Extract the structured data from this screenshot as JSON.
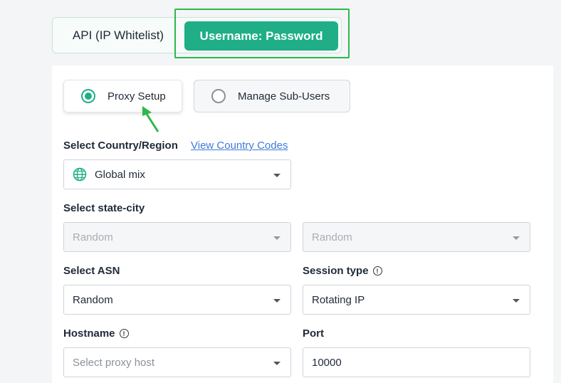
{
  "auth_tabs": {
    "api_label": "API (IP Whitelist)",
    "userpass_label": "Username: Password"
  },
  "mode_options": {
    "proxy_setup": "Proxy Setup",
    "manage_sub_users": "Manage Sub-Users"
  },
  "country": {
    "label": "Select Country/Region",
    "link": "View Country Codes",
    "value": "Global mix"
  },
  "state_city": {
    "label": "Select state-city",
    "state_value": "Random",
    "city_value": "Random"
  },
  "asn": {
    "label": "Select ASN",
    "value": "Random"
  },
  "session_type": {
    "label": "Session type",
    "value": "Rotating IP"
  },
  "hostname": {
    "label": "Hostname",
    "placeholder": "Select proxy host"
  },
  "port": {
    "label": "Port",
    "value": "10000"
  },
  "colors": {
    "accent": "#1fae86",
    "highlight": "#2db84b",
    "link": "#3f7ad8"
  }
}
